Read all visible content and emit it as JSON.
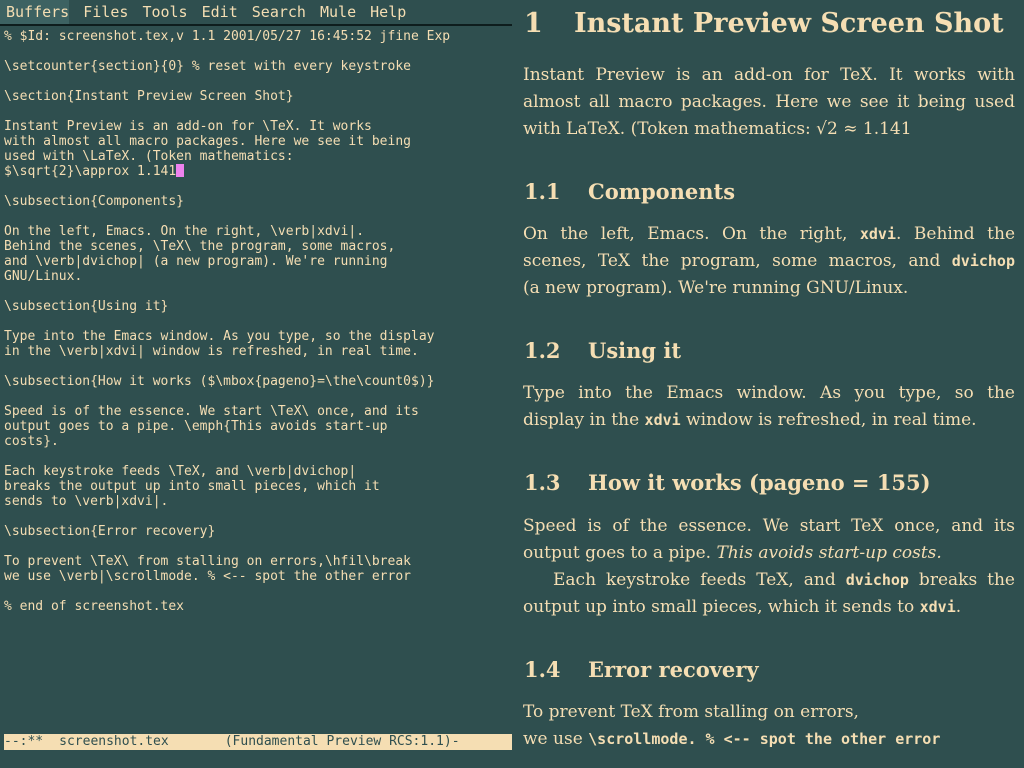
{
  "menubar": {
    "items": [
      "Buffers",
      "Files",
      "Tools",
      "Edit",
      "Search",
      "Mule",
      "Help"
    ]
  },
  "editor": {
    "lines": [
      "% $Id: screenshot.tex,v 1.1 2001/05/27 16:45:52 jfine Exp",
      "",
      "\\setcounter{section}{0} % reset with every keystroke",
      "",
      "\\section{Instant Preview Screen Shot}",
      "",
      "Instant Preview is an add-on for \\TeX. It works",
      "with almost all macro packages. Here we see it being",
      "used with \\LaTeX. (Token mathematics:",
      "$\\sqrt{2}\\approx 1.141",
      "",
      "\\subsection{Components}",
      "",
      "On the left, Emacs. On the right, \\verb|xdvi|.",
      "Behind the scenes, \\TeX\\ the program, some macros,",
      "and \\verb|dvichop| (a new program). We're running",
      "GNU/Linux.",
      "",
      "\\subsection{Using it}",
      "",
      "Type into the Emacs window. As you type, so the display",
      "in the \\verb|xdvi| window is refreshed, in real time.",
      "",
      "\\subsection{How it works ($\\mbox{pageno}=\\the\\count0$)}",
      "",
      "Speed is of the essence. We start \\TeX\\ once, and its",
      "output goes to a pipe. \\emph{This avoids start-up",
      "costs}.",
      "",
      "Each keystroke feeds \\TeX, and \\verb|dvichop|",
      "breaks the output up into small pieces, which it",
      "sends to \\verb|xdvi|.",
      "",
      "\\subsection{Error recovery}",
      "",
      "To prevent \\TeX\\ from stalling on errors,\\hfil\\break",
      "we use \\verb|\\scrollmode. % <-- spot the other error",
      "",
      "% end of screenshot.tex"
    ],
    "cursor_line": 9
  },
  "modeline": {
    "status": "--:**",
    "buffer": "screenshot.tex",
    "modes": "(Fundamental Preview RCS:1.1)-"
  },
  "preview": {
    "section": {
      "number": "1",
      "title": "Instant Preview Screen Shot"
    },
    "intro": {
      "line1": "Instant Preview is an add-on for TeX.  It works with",
      "line2": "almost all macro packages.  Here we see it being used",
      "line3": "with LaTeX. (Token mathematics: √2 ≈ 1.141"
    },
    "sub1": {
      "number": "1.1",
      "title": "Components"
    },
    "components": {
      "line1_a": "On the left, Emacs.  On the right, ",
      "line1_tt": "xdvi",
      "line1_b": ".  Behind the",
      "line2_a": "scenes, TeX the program, some macros, and ",
      "line2_tt": "dvichop",
      "line3": "(a new program).  We're running GNU/Linux."
    },
    "sub2": {
      "number": "1.2",
      "title": "Using it"
    },
    "using": {
      "line1": "Type into the Emacs window.  As you type, so the",
      "line2_a": "display in the ",
      "line2_tt": "xdvi",
      "line2_b": " window is refreshed, in real time."
    },
    "sub3": {
      "number": "1.3",
      "title": "How it works (pageno = 155)"
    },
    "how": {
      "line1": "Speed is of the essence.  We start TeX once, and its",
      "line2_a": "output goes to a pipe. ",
      "line2_em": "This avoids start-up costs.",
      "line3_a": "Each keystroke feeds TeX, and ",
      "line3_tt": "dvichop",
      "line3_b": " breaks the",
      "line4_a": "output up into small pieces, which it sends to ",
      "line4_tt": "xdvi",
      "line4_b": "."
    },
    "sub4": {
      "number": "1.4",
      "title": "Error recovery"
    },
    "error": {
      "line1": "To prevent TeX from stalling on errors,",
      "line2_a": "we use ",
      "line2_tt": "\\scrollmode. % <-- spot the other error"
    }
  },
  "colors": {
    "background": "#2f4f4f",
    "foreground": "#f5deb3",
    "cursor": "#ee82ee"
  }
}
